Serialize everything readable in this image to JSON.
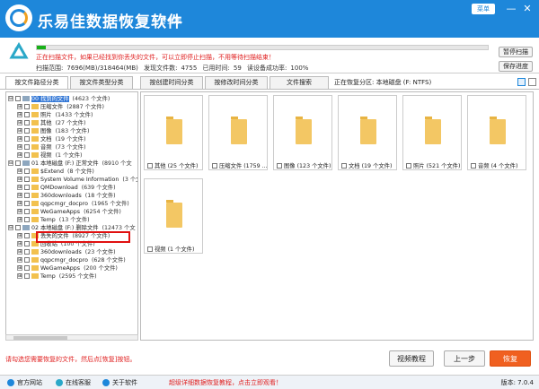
{
  "titlebar": {
    "app_name": "乐易佳数据恢复软件",
    "edition": "专业版",
    "menu": "菜单",
    "minimize": "—",
    "close": "✕"
  },
  "scan": {
    "progress": 0.02,
    "warning": "正在扫描文件，如果已经找到你丢失的文件，可以立即停止扫描，不用等待扫描结束！",
    "range_label": "扫描范围:",
    "range_value": "7696(MB)/318464(MB)",
    "found_label": "发现文件数:",
    "found_value": "4755",
    "time_label": "已用时间:",
    "time_value": "59",
    "rate_label": "读设备成功率:",
    "rate_value": "100%",
    "pause": "暂停扫描",
    "save": "保存进度"
  },
  "tabs": [
    "按文件路径分类",
    "按文件类型分类",
    "按创建时间分类",
    "按修改时间分类",
    "文件搜索"
  ],
  "current_partition": "正在恢复分区: 本地磁盘 (F: NTFS)",
  "tree": {
    "rows": [
      {
        "name": "00 找到的文件",
        "count": "(4623 个文件)",
        "level": 0,
        "exp": "⊟",
        "icon": "drive",
        "hl": true
      },
      {
        "name": "压缩文件",
        "count": "(2887 个文件)",
        "level": 1,
        "exp": "⊞",
        "icon": "fold"
      },
      {
        "name": "照片",
        "count": "(1433 个文件)",
        "level": 1,
        "exp": "⊞",
        "icon": "fold"
      },
      {
        "name": "其他",
        "count": "(27 个文件)",
        "level": 1,
        "exp": "⊞",
        "icon": "fold"
      },
      {
        "name": "图像",
        "count": "(183 个文件)",
        "level": 1,
        "exp": "⊞",
        "icon": "fold"
      },
      {
        "name": "文档",
        "count": "(19 个文件)",
        "level": 1,
        "exp": "⊞",
        "icon": "fold"
      },
      {
        "name": "音频",
        "count": "(73 个文件)",
        "level": 1,
        "exp": "⊞",
        "icon": "fold"
      },
      {
        "name": "视频",
        "count": "(1 个文件)",
        "level": 1,
        "exp": "⊞",
        "icon": "fold"
      },
      {
        "name": "01 本地磁盘 (F:) 正常文件",
        "count": "(8910 个文",
        "level": 0,
        "exp": "⊟",
        "icon": "drive"
      },
      {
        "name": "$Extend",
        "count": "(8 个文件)",
        "level": 1,
        "exp": "⊞",
        "icon": "fold"
      },
      {
        "name": "System Volume Information",
        "count": "(3 个文",
        "level": 1,
        "exp": "⊞",
        "icon": "fold"
      },
      {
        "name": "QMDownload",
        "count": "(639 个文件)",
        "level": 1,
        "exp": "⊞",
        "icon": "fold"
      },
      {
        "name": "360downloads",
        "count": "(18 个文件)",
        "level": 1,
        "exp": "⊞",
        "icon": "fold"
      },
      {
        "name": "qqpcmgr_docpro",
        "count": "(1965 个文件)",
        "level": 1,
        "exp": "⊞",
        "icon": "fold"
      },
      {
        "name": "WeGameApps",
        "count": "(6254 个文件)",
        "level": 1,
        "exp": "⊞",
        "icon": "fold"
      },
      {
        "name": "Temp",
        "count": "(13 个文件)",
        "level": 1,
        "exp": "⊞",
        "icon": "fold"
      },
      {
        "name": "02 本地磁盘 (F:) 删除文件",
        "count": "(12473 个文",
        "level": 0,
        "exp": "⊟",
        "icon": "drive"
      },
      {
        "name": "丢失的文件",
        "count": "(8927 个文件)",
        "level": 1,
        "exp": "⊞",
        "icon": "fold"
      },
      {
        "name": "回收站",
        "count": "(100 个文件)",
        "level": 1,
        "exp": "⊞",
        "icon": "fold"
      },
      {
        "name": "360downloads",
        "count": "(23 个文件)",
        "level": 1,
        "exp": "⊞",
        "icon": "fold"
      },
      {
        "name": "qqpcmgr_docpro",
        "count": "(628 个文件)",
        "level": 1,
        "exp": "⊞",
        "icon": "fold"
      },
      {
        "name": "WeGameApps",
        "count": "(200 个文件)",
        "level": 1,
        "exp": "⊞",
        "icon": "fold"
      },
      {
        "name": "Temp",
        "count": "(2595 个文件)",
        "level": 1,
        "exp": "⊞",
        "icon": "fold"
      }
    ]
  },
  "gallery": [
    {
      "label": "其他 (25 个文件)"
    },
    {
      "label": "压缩文件 (1759 ..."
    },
    {
      "label": "图像 (123 个文件)"
    },
    {
      "label": "文档 (19 个文件)"
    },
    {
      "label": "照片 (521 个文件)"
    },
    {
      "label": "音频 (4 个文件)"
    },
    {
      "label": "视频 (1 个文件)"
    }
  ],
  "bottom": {
    "hint": "请勾选您需要恢复的文件，然后点[恢复]按钮。",
    "video": "视频教程",
    "prev": "上一步",
    "recover": "恢复"
  },
  "footer": {
    "site": "官方网站",
    "support": "在线客服",
    "about": "关于软件",
    "promo": "超级详细数据恢复教程，点击立即观看！",
    "version": "版本: 7.0.4"
  },
  "colors": {
    "brand": "#1e87da",
    "warning": "#e02020",
    "recover": "#f06020",
    "progress": "#18b018"
  }
}
